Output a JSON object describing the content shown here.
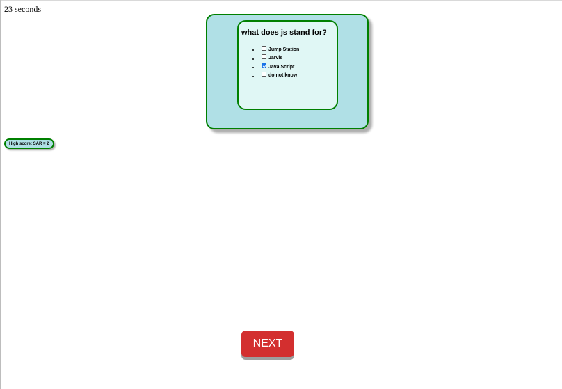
{
  "timer": {
    "text": "23 seconds"
  },
  "quiz": {
    "question": "what does js stand for?",
    "options": [
      {
        "label": "Jump Station",
        "checked": false
      },
      {
        "label": "Jarvis",
        "checked": false
      },
      {
        "label": "Java Script",
        "checked": true
      },
      {
        "label": "do not know",
        "checked": false
      }
    ]
  },
  "high_score": {
    "text": "High score: SAR = 2"
  },
  "next_button": {
    "label": "NEXT"
  },
  "colors": {
    "panel_bg": "#b0e0e6",
    "panel_border": "#008000",
    "inner_bg": "#e0f7f5",
    "next_bg": "#d32f2f",
    "checkbox_checked": "#1a73e8"
  }
}
